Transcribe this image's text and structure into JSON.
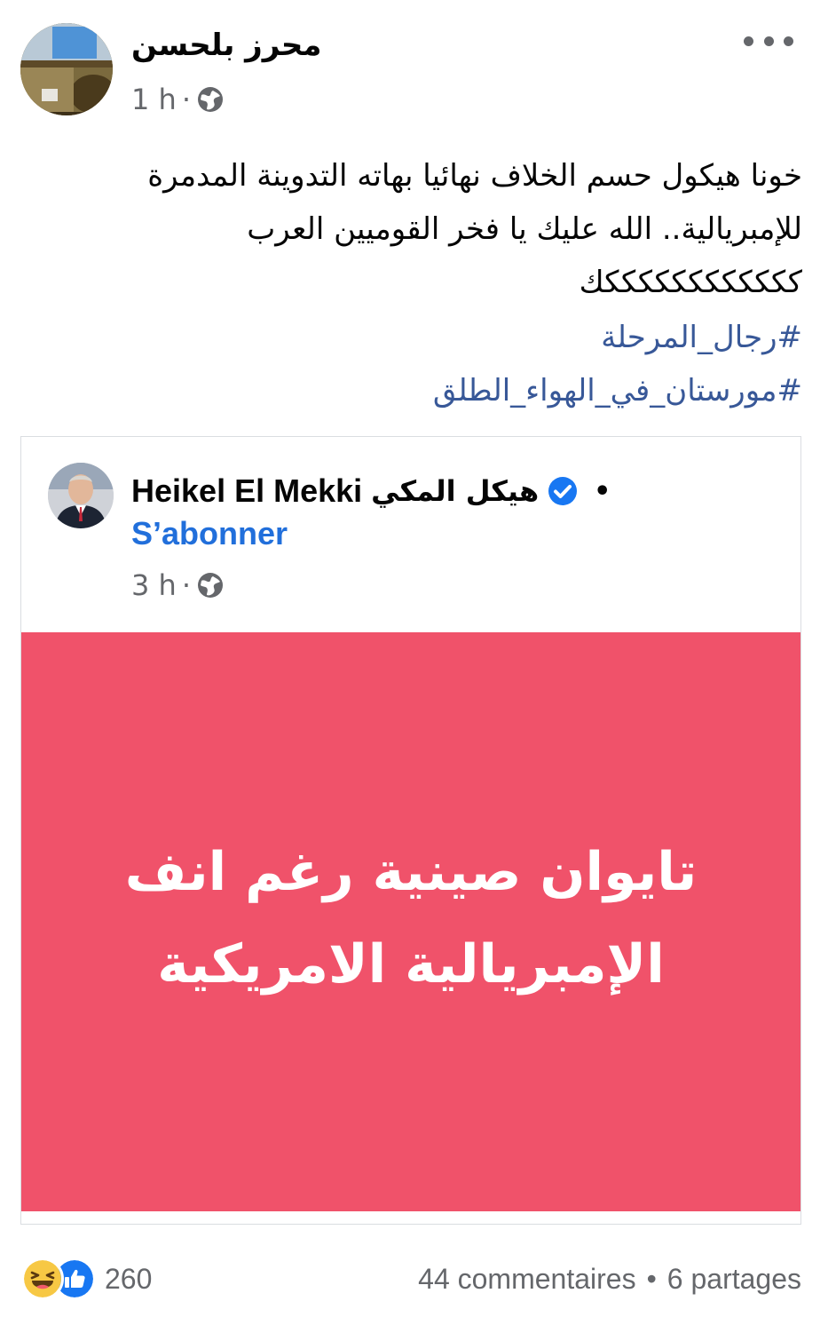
{
  "post": {
    "author": "محرز بلحسن",
    "time": "1 h",
    "meta_separator": "·",
    "privacy_icon": "globe-icon",
    "more_icon": "more-options-icon",
    "text_lines": [
      "خونا هيكول حسم الخلاف نهائيا بهاته التدوينة المدمرة",
      "للإمبريالية.. الله عليك يا فخر القوميين العرب",
      "ككككككككككككك"
    ],
    "hashtags": [
      "#رجال_المرحلة",
      "#مورستان_في_الهواء_الطلق"
    ]
  },
  "shared_post": {
    "author_latin": "Heikel El Mekki",
    "author_arabic": "هيكل المكي",
    "verified_icon": "verified-badge-icon",
    "separator": "•",
    "follow_label": "S’abonner",
    "time": "3 h",
    "meta_separator": "·",
    "privacy_icon": "globe-icon",
    "image_text_lines": [
      "تايوان صينية رغم انف",
      "الإمبريالية الامريكية"
    ],
    "image_background": "#f0526a"
  },
  "footer": {
    "reaction_icons": [
      "haha-reaction-icon",
      "like-reaction-icon"
    ],
    "reaction_count": "260",
    "comments": "44 commentaires",
    "separator": "•",
    "shares": "6 partages"
  },
  "colors": {
    "link": "#385898",
    "follow": "#216fdb",
    "meta": "#65676b",
    "image_bg": "#f0526a"
  }
}
